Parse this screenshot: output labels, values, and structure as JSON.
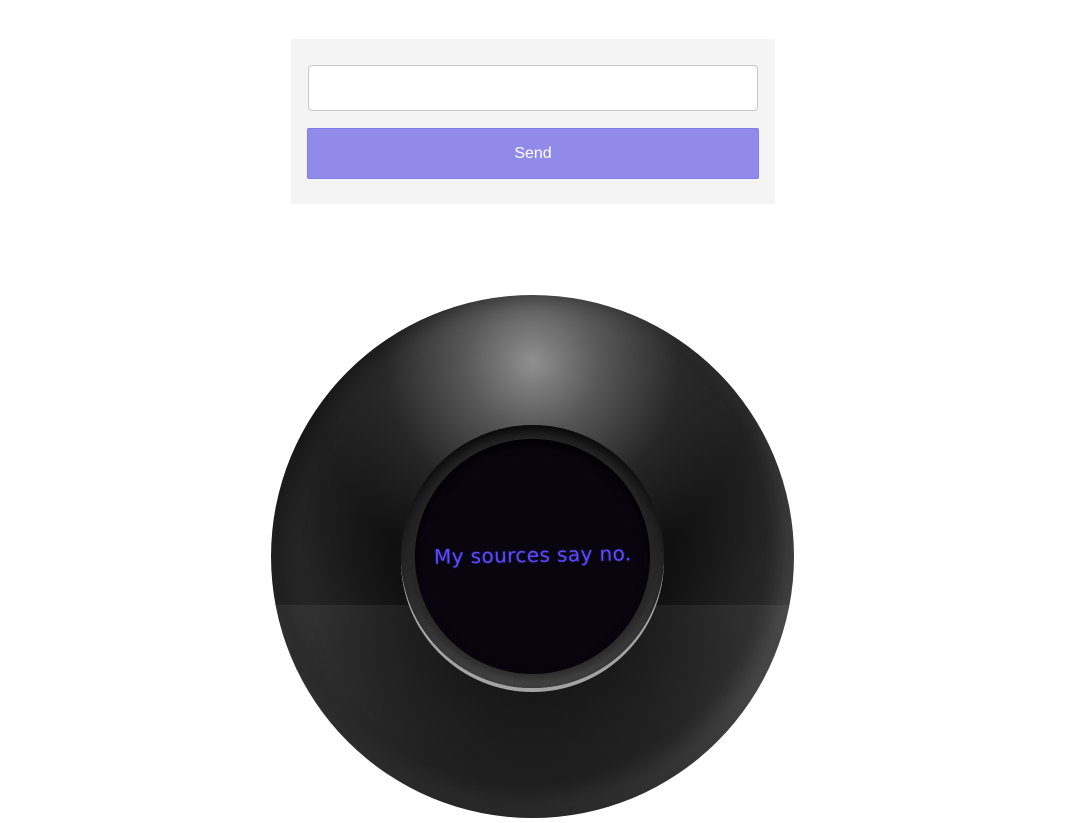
{
  "form": {
    "question_input": {
      "value": "",
      "placeholder": ""
    },
    "send_label": "Send"
  },
  "magic_ball": {
    "answer": "My sources say no."
  },
  "colors": {
    "panel_background": "#f4f4f4",
    "button_background": "#918ae8",
    "answer_text": "#5d49ff"
  }
}
